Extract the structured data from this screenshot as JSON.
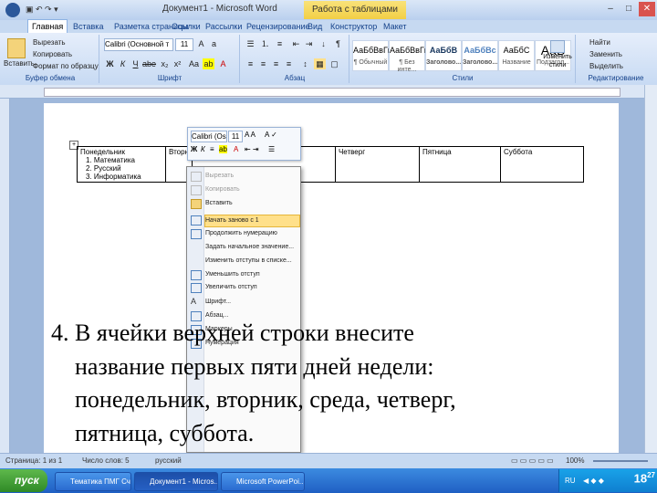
{
  "window": {
    "title": "Документ1 - Microsoft Word",
    "context_tab": "Работа с таблицами",
    "controls": [
      "–",
      "□",
      "✕"
    ]
  },
  "tabs": [
    "Главная",
    "Вставка",
    "Разметка страницы",
    "Ссылки",
    "Рассылки",
    "Рецензирование",
    "Вид",
    "Конструктор",
    "Макет"
  ],
  "ribbon": {
    "clipboard": {
      "paste": "Вставить",
      "cut": "Вырезать",
      "copy": "Копировать",
      "format": "Формат по образцу",
      "label": "Буфер обмена"
    },
    "font": {
      "name": "Calibri (Основной т",
      "size": "11",
      "label": "Шрифт"
    },
    "paragraph": {
      "label": "Абзац"
    },
    "styles": {
      "items": [
        {
          "sample": "АаБбВвГг",
          "name": "¶ Обычный"
        },
        {
          "sample": "АаБбВвГг",
          "name": "¶ Без инте..."
        },
        {
          "sample": "АаБбВ",
          "name": "Заголово..."
        },
        {
          "sample": "АаБбВс",
          "name": "Заголово..."
        },
        {
          "sample": "АаБбС",
          "name": "Название"
        },
        {
          "sample": "АаВ",
          "name": "Подзагол..."
        }
      ],
      "change": "Изменить стили",
      "label": "Стили"
    },
    "editing": {
      "find": "Найти",
      "replace": "Заменить",
      "select": "Выделить",
      "label": "Редактирование"
    }
  },
  "table": {
    "headers": [
      "Понедельник",
      "Вторн",
      "",
      "Четверг",
      "Пятница",
      "Суббота"
    ],
    "list": [
      "1.  Математика",
      "2.  Русский",
      "3.  Информатика"
    ]
  },
  "mini_toolbar": {
    "font": "Calibri (Os",
    "size": "11"
  },
  "context_menu": {
    "items": [
      {
        "label": "Вырезать",
        "state": "disabled"
      },
      {
        "label": "Копировать",
        "state": "disabled"
      },
      {
        "label": "Вставить",
        "state": "normal"
      },
      {
        "label": "Начать заново с 1",
        "state": "highlighted"
      },
      {
        "label": "Продолжить нумерацию",
        "state": "normal"
      },
      {
        "label": "Задать начальное значение...",
        "state": "normal"
      },
      {
        "label": "Изменить отступы в списке...",
        "state": "normal"
      },
      {
        "label": "Уменьшить отступ",
        "state": "normal"
      },
      {
        "label": "Увеличить отступ",
        "state": "normal"
      },
      {
        "label": "Шрифт...",
        "state": "normal"
      },
      {
        "label": "Абзац...",
        "state": "normal"
      },
      {
        "label": "Маркеры",
        "state": "normal"
      },
      {
        "label": "Нумерация",
        "state": "normal"
      }
    ]
  },
  "instruction": {
    "lines": [
      "4. В ячейки верхней строки внесите",
      "название первых пяти дней недели:",
      "понедельник, вторник, среда, четверг,",
      "пятница, суббота."
    ]
  },
  "status": {
    "page": "Страница: 1 из 1",
    "words": "Число слов: 5",
    "lang": "русский",
    "zoom": "100%"
  },
  "taskbar": {
    "start": "пуск",
    "tasks": [
      {
        "label": "Тематика ПМГ Сч...",
        "active": false
      },
      {
        "label": "Документ1 - Micros...",
        "active": true
      },
      {
        "label": "Microsoft PowerPoi...",
        "active": false
      }
    ],
    "lang": "RU",
    "clock": "18",
    "clock_sup": "27"
  },
  "colors": {
    "ribbon_blue": "#c6d9f1",
    "highlight": "#ffe08a",
    "taskbar": "#2a6bd0",
    "start_green": "#3a9a2e"
  }
}
